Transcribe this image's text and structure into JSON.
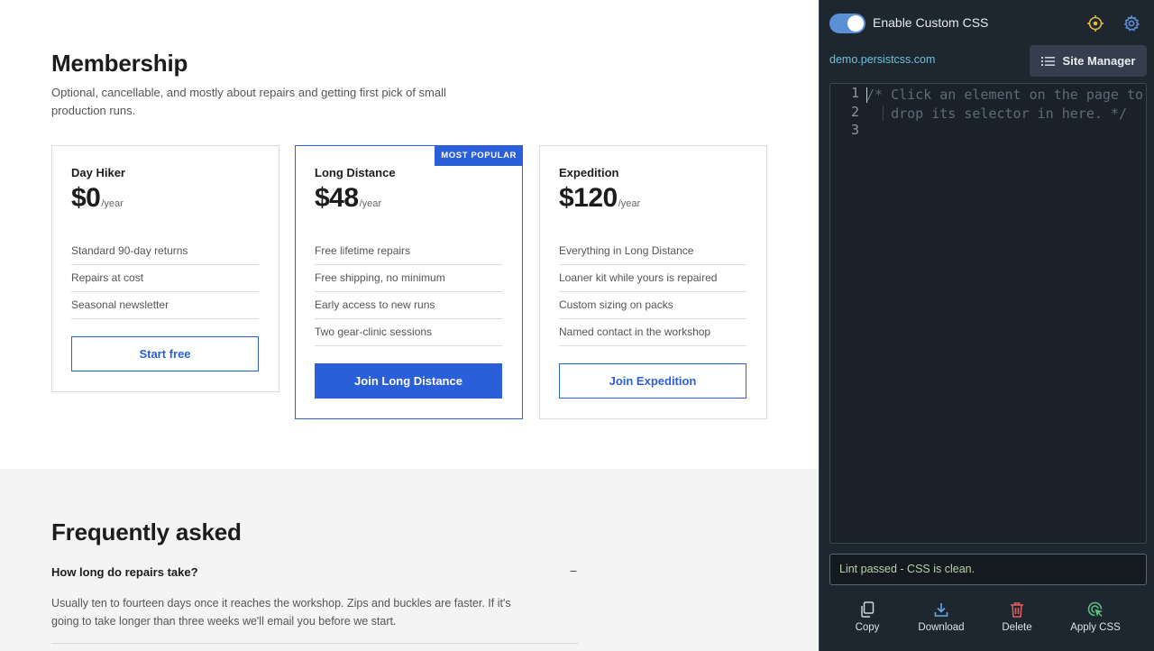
{
  "membership": {
    "title": "Membership",
    "subtitle": "Optional, cancellable, and mostly about repairs and getting first pick of small production runs.",
    "plans": [
      {
        "name": "Day Hiker",
        "price": "$0",
        "unit": "/year",
        "features": [
          "Standard 90-day returns",
          "Repairs at cost",
          "Seasonal newsletter"
        ],
        "button": "Start free"
      },
      {
        "name": "Long Distance",
        "price": "$48",
        "unit": "/year",
        "badge": "MOST POPULAR",
        "features": [
          "Free lifetime repairs",
          "Free shipping, no minimum",
          "Early access to new runs",
          "Two gear-clinic sessions"
        ],
        "button": "Join Long Distance"
      },
      {
        "name": "Expedition",
        "price": "$120",
        "unit": "/year",
        "features": [
          "Everything in Long Distance",
          "Loaner kit while yours is repaired",
          "Custom sizing on packs",
          "Named contact in the workshop"
        ],
        "button": "Join Expedition"
      }
    ]
  },
  "faq": {
    "title": "Frequently asked",
    "items": [
      {
        "question": "How long do repairs take?",
        "toggle": "−",
        "answer": "Usually ten to fourteen days once it reaches the workshop. Zips and buckles are faster. If it's going to take longer than three weeks we'll email you before we start."
      }
    ]
  },
  "panel": {
    "toggle_label": "Enable Custom CSS",
    "toggle_on": true,
    "domain": "demo.persistcss.com",
    "site_manager_label": "Site Manager",
    "editor": {
      "line_numbers": [
        "1",
        "2",
        "3"
      ],
      "lines": [
        "/* Click an element on the page to",
        "   drop its selector in here. */",
        ""
      ]
    },
    "lint_message": "Lint passed - CSS is clean.",
    "actions": {
      "copy": "Copy",
      "download": "Download",
      "delete": "Delete",
      "apply": "Apply CSS"
    },
    "icons": [
      "target-icon",
      "gear-icon",
      "list-icon",
      "copy-icon",
      "download-icon",
      "trash-icon",
      "apply-cursor-icon"
    ],
    "colors": {
      "accent": "#2b5fd9",
      "toggle": "#5b8fd6",
      "domain": "#6cc3d9",
      "target_icon": "#e2b93b",
      "delete_icon": "#e05d5d",
      "apply_icon": "#5cbf83",
      "lint_text": "#b7d3a8"
    }
  }
}
